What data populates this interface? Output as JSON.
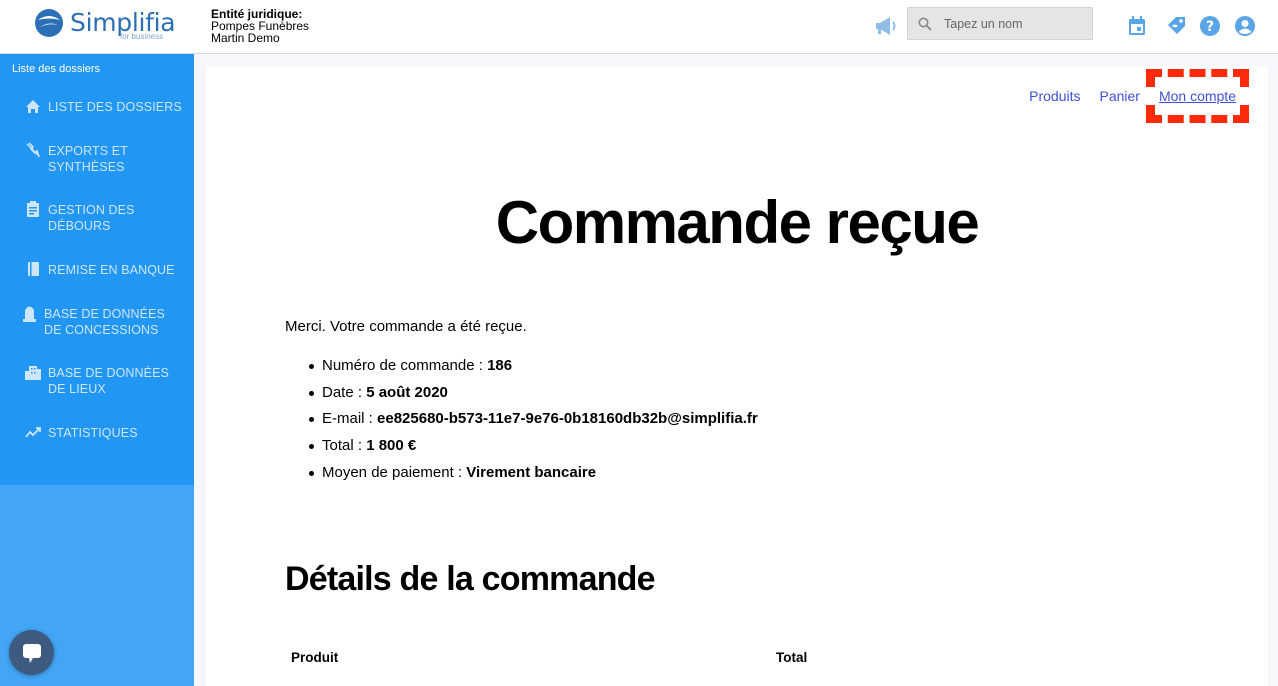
{
  "header": {
    "brand": "Simplifia",
    "brand_sub": "for business",
    "entity_label": "Entité juridique:",
    "entity_line1": "Pompes Funèbres",
    "entity_line2": "Martin Demo",
    "search_placeholder": "Tapez un nom",
    "icons": [
      "megaphone-icon",
      "search-icon",
      "calendar-icon",
      "tag-icon",
      "help-icon",
      "account-icon"
    ]
  },
  "sidebar": {
    "title": "Liste des dossiers",
    "items": [
      {
        "label_1": "Liste des dossiers",
        "label_2": "",
        "icon": "home-icon"
      },
      {
        "label_1": "Exports et",
        "label_2": "synthèses",
        "icon": "export-icon"
      },
      {
        "label_1": "Gestion des",
        "label_2": "débours",
        "icon": "clipboard-icon"
      },
      {
        "label_1": "Remise en banque",
        "label_2": "",
        "icon": "bank-book-icon"
      },
      {
        "label_1": "Base de données",
        "label_2": "de concessions",
        "icon": "tombstone-icon"
      },
      {
        "label_1": "Base de données",
        "label_2": "de lieux",
        "icon": "building-icon"
      },
      {
        "label_1": "Statistiques",
        "label_2": "",
        "icon": "trend-icon"
      }
    ]
  },
  "main": {
    "nav": {
      "products": "Produits",
      "cart": "Panier",
      "account": "Mon compte"
    },
    "title": "Commande reçue",
    "thanks": "Merci. Votre commande a été reçue.",
    "order": [
      {
        "label": "Numéro de commande : ",
        "value": "186"
      },
      {
        "label": "Date : ",
        "value": "5 août 2020"
      },
      {
        "label": "E-mail : ",
        "value": "ee825680-b573-11e7-9e76-0b18160db32b@simplifia.fr"
      },
      {
        "label": "Total : ",
        "value": "1 800 €"
      },
      {
        "label": "Moyen de paiement : ",
        "value": "Virement bancaire"
      }
    ],
    "details_title": "Détails de la commande",
    "table_headers": {
      "product": "Produit",
      "total": "Total"
    }
  },
  "colors": {
    "sidebar_active": "#2196f3",
    "sidebar": "#42a5f5",
    "link": "#3f51d6",
    "highlight": "#ff2a0a",
    "brand": "#2b6fb6"
  }
}
